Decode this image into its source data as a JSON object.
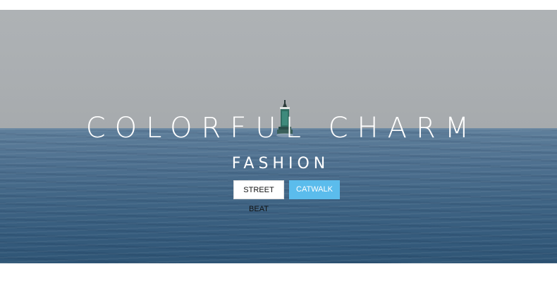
{
  "hero": {
    "headline": "COLORFUL CHARM",
    "subheadline": "FASHION",
    "buttons": {
      "street_beat": "STREET BEAT",
      "catwalk": "CATWALK"
    },
    "image": "sea-buoy-photo"
  },
  "colors": {
    "accent": "#5bbcec",
    "text": "#ffffff",
    "sea": "#3f6484",
    "sky": "#aaaeb1"
  }
}
